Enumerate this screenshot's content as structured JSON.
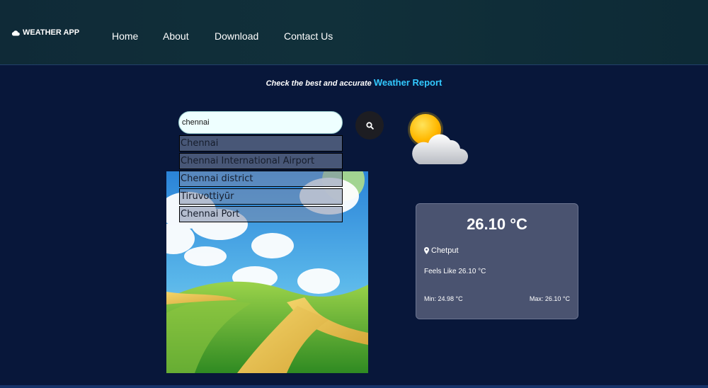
{
  "brand": {
    "name": "WEATHER APP",
    "icon": "cloud-icon"
  },
  "nav": {
    "home": "Home",
    "about": "About",
    "download": "Download",
    "contact": "Contact Us"
  },
  "tagline": {
    "text": "Check the best and accurate",
    "highlight": "Weather Report",
    "highlight_color": "#32c9ff"
  },
  "search": {
    "value": "chennai",
    "button_icon": "search-icon"
  },
  "suggestions": [
    "Chennai",
    "Chennai International Airport",
    "Chennai district",
    "Tiruvottiyūr",
    "Chennai Port"
  ],
  "weather_icon": "partly-cloudy-icon",
  "card": {
    "temperature": "26.10 °C",
    "location": "Chetput",
    "feels_like": "Feels Like 26.10 °C",
    "min": "Min: 24.98 °C",
    "max": "Max: 26.10 °C"
  },
  "colors": {
    "page_bg": "#08173a",
    "navbar_bg": "#11303a",
    "card_bg": "#4a5370",
    "input_bg": "#eeffff"
  }
}
